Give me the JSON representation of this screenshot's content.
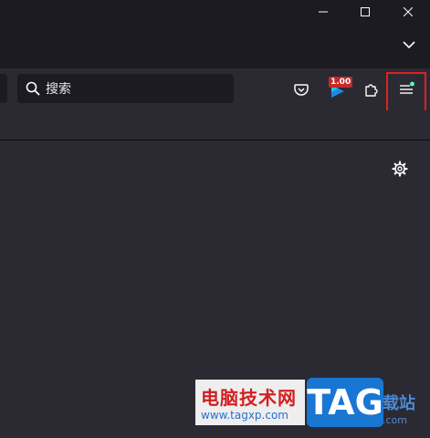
{
  "window_controls": {
    "minimize": "minimize-icon",
    "maximize": "maximize-icon",
    "close": "close-icon",
    "list_all_tabs": "chevron-down-icon"
  },
  "toolbar": {
    "search": {
      "placeholder": "搜索",
      "icon": "search-icon"
    },
    "pocket_icon": "pocket-icon",
    "extension": {
      "badge": "1.00",
      "icon": "play-extension-icon"
    },
    "extensions_icon": "puzzle-icon",
    "app_menu_icon": "hamburger-menu-icon",
    "app_menu_dot_color": "#54ffbd",
    "highlight_color": "#e02020"
  },
  "content": {
    "settings_icon": "gear-icon"
  },
  "watermark": {
    "title": "电脑技术网",
    "url": "www.tagxp.com",
    "tag": "TAG",
    "right_text": "载站",
    "right_url": ".com"
  },
  "colors": {
    "titlebar": "#1c1b22",
    "toolbar": "#2b2a33",
    "field": "#1c1b22",
    "text": "#fbfbfe"
  }
}
